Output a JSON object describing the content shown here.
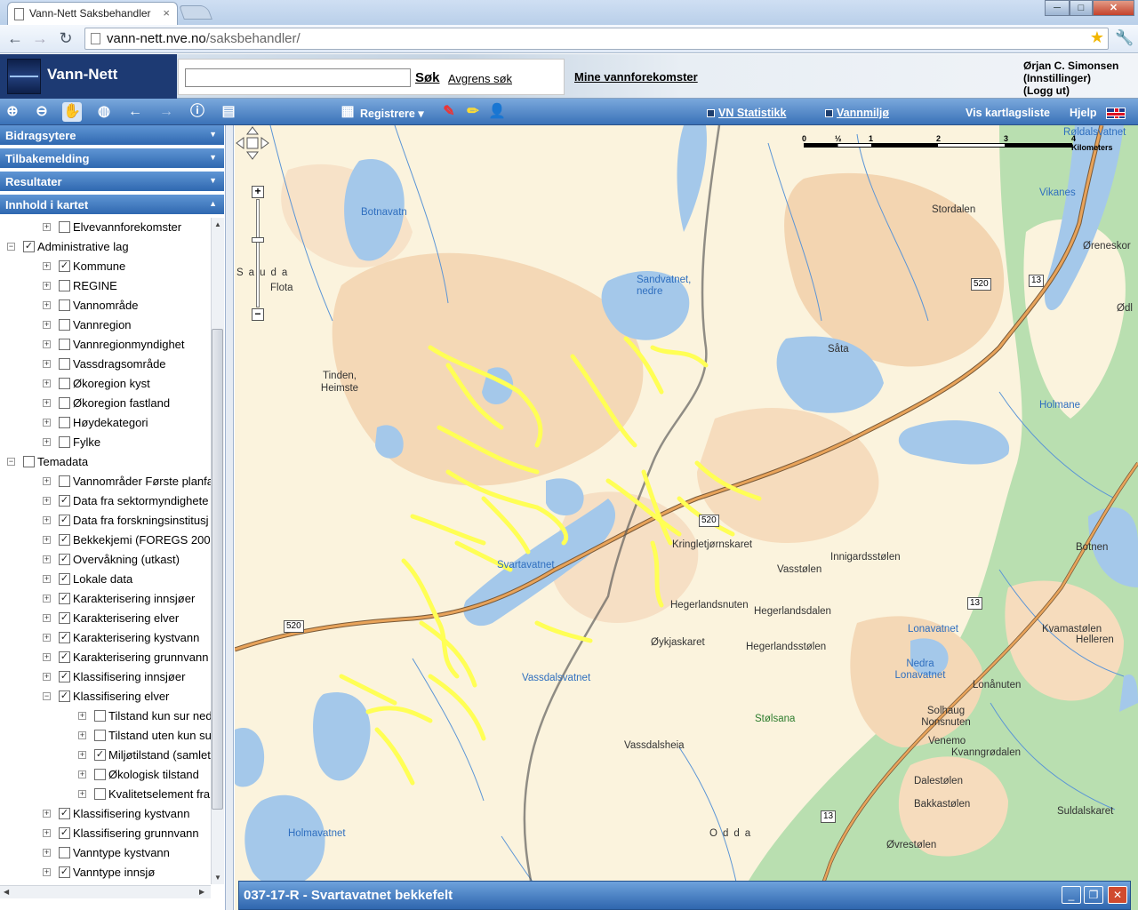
{
  "browser": {
    "tab_title": "Vann-Nett Saksbehandler",
    "tab_close": "×",
    "url_host": "vann-nett.nve.no",
    "url_path": "/saksbehandler/",
    "win_min": "─",
    "win_max": "□",
    "win_close": "✕"
  },
  "header": {
    "app_name": "Vann-Nett",
    "search_value": "",
    "search_button": "Søk",
    "refine_link": "Avgrens søk",
    "my_water_link": "Mine vannforekomster",
    "user_name": "Ørjan C. Simonsen",
    "settings_link": "(Innstillinger)",
    "logout_link": "(Logg ut)"
  },
  "maptoolbar": {
    "register": "Registrere",
    "stats": "VN Statistikk",
    "env": "Vannmiljø",
    "layers": "Vis kartlagsliste",
    "help": "Hjelp"
  },
  "sidebar": {
    "panels": [
      "Bidragsytere",
      "Tilbakemelding",
      "Resultater",
      "Innhold i kartet"
    ],
    "tree": [
      {
        "label": "Elvevannforekomster",
        "level": 1,
        "checked": false,
        "expander": "+"
      },
      {
        "label": "Administrative lag",
        "level": 0,
        "checked": true,
        "expander": "−"
      },
      {
        "label": "Kommune",
        "level": 1,
        "checked": true,
        "expander": "+"
      },
      {
        "label": "REGINE",
        "level": 1,
        "checked": false,
        "expander": "+"
      },
      {
        "label": "Vannområde",
        "level": 1,
        "checked": false,
        "expander": "+"
      },
      {
        "label": "Vannregion",
        "level": 1,
        "checked": false,
        "expander": "+"
      },
      {
        "label": "Vannregionmyndighet",
        "level": 1,
        "checked": false,
        "expander": "+"
      },
      {
        "label": "Vassdragsområde",
        "level": 1,
        "checked": false,
        "expander": "+"
      },
      {
        "label": "Økoregion kyst",
        "level": 1,
        "checked": false,
        "expander": "+"
      },
      {
        "label": "Økoregion fastland",
        "level": 1,
        "checked": false,
        "expander": "+"
      },
      {
        "label": "Høydekategori",
        "level": 1,
        "checked": false,
        "expander": "+"
      },
      {
        "label": "Fylke",
        "level": 1,
        "checked": false,
        "expander": "+"
      },
      {
        "label": "Temadata",
        "level": 0,
        "checked": false,
        "expander": "−"
      },
      {
        "label": "Vannområder Første planfa",
        "level": 1,
        "checked": false,
        "expander": "+"
      },
      {
        "label": "Data fra sektormyndighete",
        "level": 1,
        "checked": true,
        "expander": "+"
      },
      {
        "label": "Data fra forskningsinstitusj",
        "level": 1,
        "checked": true,
        "expander": "+"
      },
      {
        "label": "Bekkekjemi (FOREGS 2008",
        "level": 1,
        "checked": true,
        "expander": "+"
      },
      {
        "label": "Overvåkning (utkast)",
        "level": 1,
        "checked": true,
        "expander": "+"
      },
      {
        "label": "Lokale data",
        "level": 1,
        "checked": true,
        "expander": "+"
      },
      {
        "label": "Karakterisering innsjøer",
        "level": 1,
        "checked": true,
        "expander": "+"
      },
      {
        "label": "Karakterisering elver",
        "level": 1,
        "checked": true,
        "expander": "+"
      },
      {
        "label": "Karakterisering kystvann",
        "level": 1,
        "checked": true,
        "expander": "+"
      },
      {
        "label": "Karakterisering grunnvann",
        "level": 1,
        "checked": true,
        "expander": "+"
      },
      {
        "label": "Klassifisering innsjøer",
        "level": 1,
        "checked": true,
        "expander": "+"
      },
      {
        "label": "Klassifisering elver",
        "level": 1,
        "checked": true,
        "expander": "−"
      },
      {
        "label": "Tilstand kun sur ned",
        "level": 2,
        "checked": false,
        "expander": "+"
      },
      {
        "label": "Tilstand uten kun su",
        "level": 2,
        "checked": false,
        "expander": "+"
      },
      {
        "label": "Miljøtilstand (samlet",
        "level": 2,
        "checked": true,
        "expander": "+"
      },
      {
        "label": "Økologisk tilstand",
        "level": 2,
        "checked": false,
        "expander": "+"
      },
      {
        "label": "Kvalitetselement fra",
        "level": 2,
        "checked": false,
        "expander": "+"
      },
      {
        "label": "Klassifisering kystvann",
        "level": 1,
        "checked": true,
        "expander": "+"
      },
      {
        "label": "Klassifisering grunnvann",
        "level": 1,
        "checked": true,
        "expander": "+"
      },
      {
        "label": "Vanntype kystvann",
        "level": 1,
        "checked": false,
        "expander": "+"
      },
      {
        "label": "Vanntype innsjø",
        "level": 1,
        "checked": true,
        "expander": "+"
      }
    ]
  },
  "map": {
    "scale_labels": [
      "0",
      "½",
      "1",
      "2",
      "3",
      "4 Kilometers"
    ],
    "water_labels": [
      "Røldalsvatnet",
      "Botnavatn",
      "Vikanes",
      "Sandvatnet, nedre",
      "Holmane",
      "Svartavatnet",
      "Lonavatnet",
      "Nedra Lonavatnet",
      "Vassdalsvatnet",
      "Holmavatnet",
      "Stølsana"
    ],
    "place_labels": [
      "Stordalen",
      "Øreneskor",
      "Sauda",
      "Flota",
      "Tinden, Heimste",
      "Såta",
      "Ødl",
      "Innigardsstølen",
      "Vasstølen",
      "Kringletjørnskaret",
      "Hegerlandsnuten",
      "Hegerlandsdalen",
      "Hegerlandsstølen",
      "Øykjaskaret",
      "Kvamastølen",
      "Helleren",
      "Lonånuten",
      "Botnen",
      "Solhaug Nonsnuten",
      "Venemo",
      "Kvanngrødalen",
      "Dalestølen",
      "Bakkastølen",
      "Vassdalsheia",
      "Suldalskaret",
      "Øvrestølen",
      "Odda"
    ],
    "road_shields": [
      "520",
      "13",
      "520",
      "13",
      "520",
      "13"
    ],
    "colors": {
      "water": "#a4c8ea",
      "land": "#fbf3dd",
      "high": "#f3d0a8",
      "forest": "#b9dfb0",
      "river_highlight": "#ffff55",
      "road": "#d9924a"
    }
  },
  "infopanel": {
    "title": "037-17-R - Svartavatnet bekkefelt"
  }
}
